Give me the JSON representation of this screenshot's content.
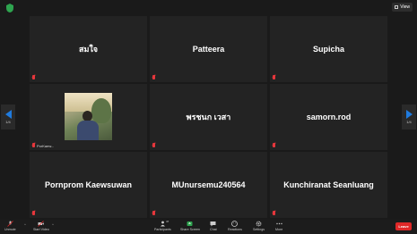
{
  "top": {
    "view_label": "View"
  },
  "tiles": [
    {
      "name": "สมใจ",
      "small_name": ""
    },
    {
      "name": "Patteera",
      "small_name": ""
    },
    {
      "name": "Supicha",
      "small_name": ""
    },
    {
      "name": "",
      "small_name": "PorKaew..."
    },
    {
      "name": "พรชนก เวสา",
      "small_name": ""
    },
    {
      "name": "samorn.rod",
      "small_name": ""
    },
    {
      "name": "Pornprom Kaewsuwan",
      "small_name": ""
    },
    {
      "name": "MUnursemu240564",
      "small_name": ""
    },
    {
      "name": "Kunchiranat Seanluang",
      "small_name": ""
    }
  ],
  "pagination": {
    "left": "1/4",
    "right": "1/4"
  },
  "toolbar": {
    "unmute": "Unmute",
    "start_video": "Start Video",
    "participants": "Participants",
    "participants_count": "47",
    "share_screen": "Share Screen",
    "chat": "Chat",
    "reactions": "Reactions",
    "settings": "Settings",
    "more": "More",
    "leave": "Leave"
  },
  "colors": {
    "accent": "#1f7bde",
    "danger": "#e02828",
    "share": "#2ea44f"
  }
}
